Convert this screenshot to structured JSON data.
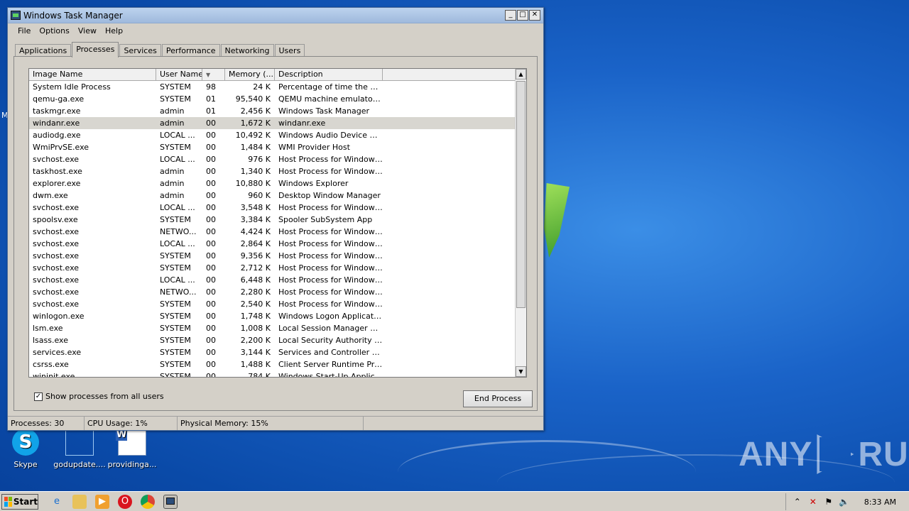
{
  "window": {
    "title": "Windows Task Manager",
    "controls": [
      "_",
      "□",
      "✕"
    ]
  },
  "menu": [
    "File",
    "Options",
    "View",
    "Help"
  ],
  "tabs": [
    "Applications",
    "Processes",
    "Services",
    "Performance",
    "Networking",
    "Users"
  ],
  "active_tab": "Processes",
  "columns": [
    "Image Name",
    "User Name",
    "",
    "Memory (...",
    "Description"
  ],
  "processes": [
    [
      "System Idle Process",
      "SYSTEM",
      "98",
      "24 K",
      "Percentage of time the pro..."
    ],
    [
      "qemu-ga.exe",
      "SYSTEM",
      "01",
      "95,540 K",
      "QEMU machine emulators ..."
    ],
    [
      "taskmgr.exe",
      "admin",
      "01",
      "2,456 K",
      "Windows Task Manager"
    ],
    [
      "windanr.exe",
      "admin",
      "00",
      "1,672 K",
      "windanr.exe"
    ],
    [
      "audiodg.exe",
      "LOCAL ...",
      "00",
      "10,492 K",
      "Windows Audio Device Gra..."
    ],
    [
      "WmiPrvSE.exe",
      "SYSTEM",
      "00",
      "1,484 K",
      "WMI Provider Host"
    ],
    [
      "svchost.exe",
      "LOCAL ...",
      "00",
      "976 K",
      "Host Process for Windows ..."
    ],
    [
      "taskhost.exe",
      "admin",
      "00",
      "1,340 K",
      "Host Process for Windows ..."
    ],
    [
      "explorer.exe",
      "admin",
      "00",
      "10,880 K",
      "Windows Explorer"
    ],
    [
      "dwm.exe",
      "admin",
      "00",
      "960 K",
      "Desktop Window Manager"
    ],
    [
      "svchost.exe",
      "LOCAL ...",
      "00",
      "3,548 K",
      "Host Process for Windows ..."
    ],
    [
      "spoolsv.exe",
      "SYSTEM",
      "00",
      "3,384 K",
      "Spooler SubSystem App"
    ],
    [
      "svchost.exe",
      "NETWO...",
      "00",
      "4,424 K",
      "Host Process for Windows ..."
    ],
    [
      "svchost.exe",
      "LOCAL ...",
      "00",
      "2,864 K",
      "Host Process for Windows ..."
    ],
    [
      "svchost.exe",
      "SYSTEM",
      "00",
      "9,356 K",
      "Host Process for Windows ..."
    ],
    [
      "svchost.exe",
      "SYSTEM",
      "00",
      "2,712 K",
      "Host Process for Windows ..."
    ],
    [
      "svchost.exe",
      "LOCAL ...",
      "00",
      "6,448 K",
      "Host Process for Windows ..."
    ],
    [
      "svchost.exe",
      "NETWO...",
      "00",
      "2,280 K",
      "Host Process for Windows ..."
    ],
    [
      "svchost.exe",
      "SYSTEM",
      "00",
      "2,540 K",
      "Host Process for Windows ..."
    ],
    [
      "winlogon.exe",
      "SYSTEM",
      "00",
      "1,748 K",
      "Windows Logon Application"
    ],
    [
      "lsm.exe",
      "SYSTEM",
      "00",
      "1,008 K",
      "Local Session Manager Ser..."
    ],
    [
      "lsass.exe",
      "SYSTEM",
      "00",
      "2,200 K",
      "Local Security Authority Pr..."
    ],
    [
      "services.exe",
      "SYSTEM",
      "00",
      "3,144 K",
      "Services and Controller app"
    ],
    [
      "csrss.exe",
      "SYSTEM",
      "00",
      "1,488 K",
      "Client Server Runtime Proc..."
    ],
    [
      "wininit.exe",
      "SYSTEM",
      "00",
      "784 K",
      "Windows Start-Up Applicat..."
    ]
  ],
  "selected_row": 3,
  "show_all_label": "Show processes from all users",
  "show_all_checked": true,
  "end_process_label": "End Process",
  "status": {
    "processes": "Processes: 30",
    "cpu": "CPU Usage: 1%",
    "memory": "Physical Memory: 15%"
  },
  "desktop_icons": [
    {
      "label": "Skype",
      "icon": "skype-icon"
    },
    {
      "label": "godupdate....",
      "icon": "blank-file-icon"
    },
    {
      "label": "providinga...",
      "icon": "word-document-icon"
    }
  ],
  "desktop_edge_text": "M",
  "watermark": {
    "left": "ANY",
    "right": "RUN"
  },
  "taskbar": {
    "start_label": "Start",
    "clock": "8:33 AM"
  },
  "taskbar_icons": [
    "ie-icon",
    "explorer-folder-icon",
    "media-player-icon",
    "opera-icon",
    "chrome-icon",
    "task-manager-icon"
  ],
  "tray_icons": [
    "chevron-up-icon",
    "network-error-icon",
    "flag-icon",
    "volume-icon"
  ]
}
